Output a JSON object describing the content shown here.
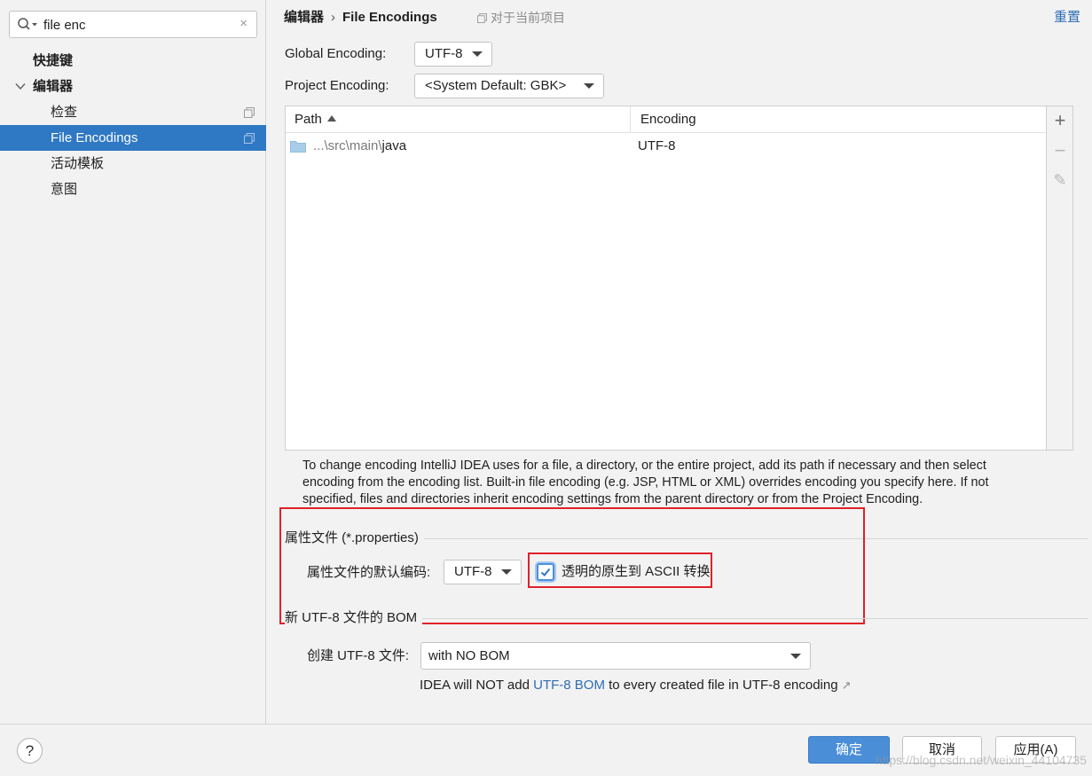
{
  "search": {
    "value": "file enc",
    "clear": "×"
  },
  "sidebar": {
    "items": [
      {
        "label": "快捷键"
      },
      {
        "label": "编辑器"
      },
      {
        "label": "检查"
      },
      {
        "label": "File Encodings"
      },
      {
        "label": "活动模板"
      },
      {
        "label": "意图"
      }
    ]
  },
  "header": {
    "breadcrumb_parent": "编辑器",
    "breadcrumb_sep": "›",
    "breadcrumb_current": "File Encodings",
    "scope": "对于当前项目",
    "reset": "重置"
  },
  "global_encoding": {
    "label": "Global Encoding:",
    "value": "UTF-8"
  },
  "project_encoding": {
    "label": "Project Encoding:",
    "value": "<System Default: GBK>"
  },
  "table": {
    "col_path": "Path",
    "col_encoding": "Encoding",
    "rows": [
      {
        "path_prefix": "...\\src\\main\\",
        "path_leaf": "java",
        "encoding": "UTF-8"
      }
    ]
  },
  "tools": {
    "add": "+",
    "remove": "−",
    "edit": "✎"
  },
  "help_text": "To change encoding IntelliJ IDEA uses for a file, a directory, or the entire project, add its path if necessary and then select encoding from the encoding list. Built-in file encoding (e.g. JSP, HTML or XML) overrides encoding you specify here. If not specified, files and directories inherit encoding settings from the parent directory or from the Project Encoding.",
  "properties": {
    "title": "属性文件 (*.properties)",
    "default_label": "属性文件的默认编码:",
    "default_value": "UTF-8",
    "ascii_label": "透明的原生到 ASCII 转换",
    "ascii_checked": true
  },
  "bom": {
    "title": "新 UTF-8 文件的 BOM",
    "create_label": "创建 UTF-8 文件:",
    "create_value": "with NO BOM",
    "note_before": "IDEA will NOT add ",
    "note_link": "UTF-8 BOM",
    "note_after": " to every created file in UTF-8 encoding",
    "note_ext": "↗"
  },
  "footer": {
    "help": "?",
    "ok": "确定",
    "cancel": "取消",
    "apply": "应用(A)",
    "watermark": "https://blog.csdn.net/weixin_44104735"
  },
  "colors": {
    "selection": "#2f78c4",
    "primary_button": "#4a8ed8",
    "link": "#2f6db5",
    "highlight_box": "#e0212b"
  }
}
